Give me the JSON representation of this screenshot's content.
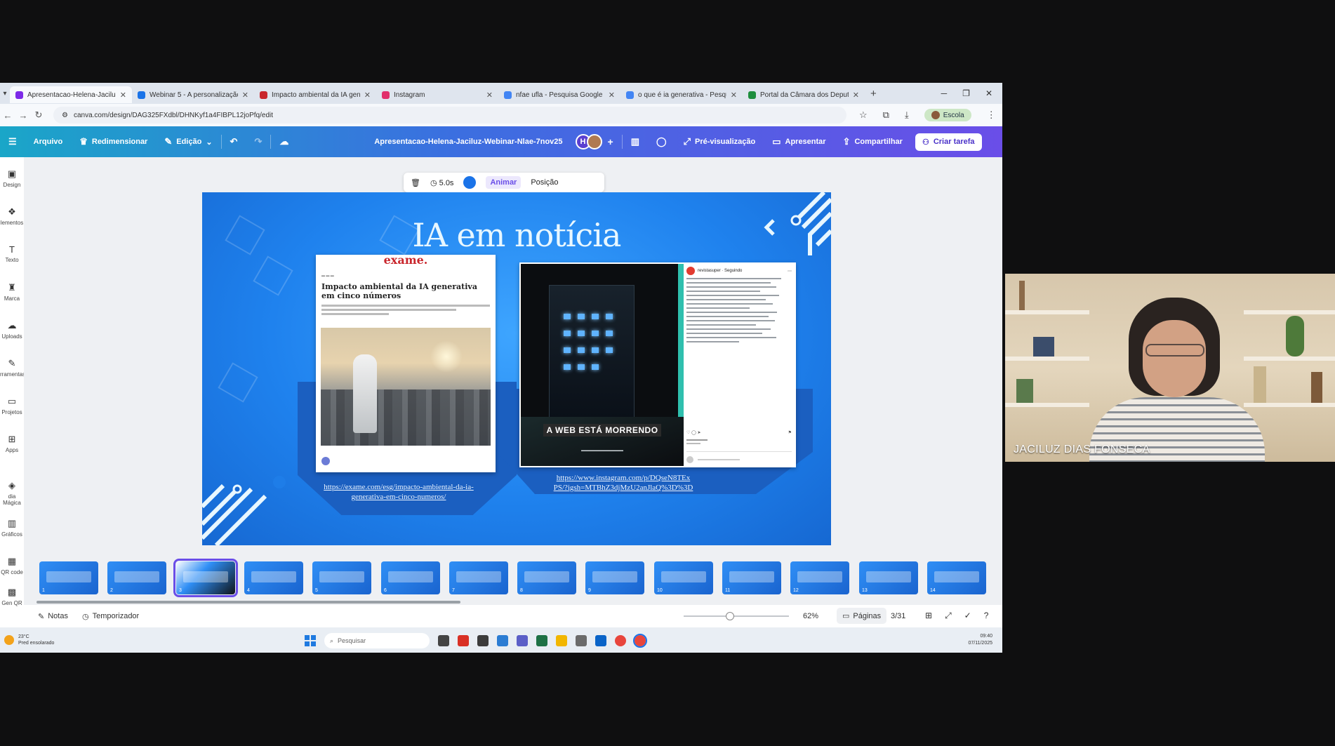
{
  "browser": {
    "tabs": [
      {
        "title": "Apresentacao-Helena-Jaciluz-W",
        "active": true,
        "favicon_color": "#7d2ae8"
      },
      {
        "title": "Webinar 5 - A personalização d",
        "active": false,
        "favicon_color": "#1a73e8"
      },
      {
        "title": "Impacto ambiental da IA gene",
        "active": false,
        "favicon_color": "#c9262c"
      },
      {
        "title": "Instagram",
        "active": false,
        "favicon_color": "#e1306c"
      },
      {
        "title": "nfae ufla - Pesquisa Google",
        "active": false,
        "favicon_color": "#4285f4"
      },
      {
        "title": "o que é ia generativa - Pesqui",
        "active": false,
        "favicon_color": "#4285f4"
      },
      {
        "title": "Portal da Câmara dos Deputad",
        "active": false,
        "favicon_color": "#1e8e3e"
      }
    ],
    "url": "canva.com/design/DAG325FXdbl/DHNKyf1a4FIBPL12joPfq/edit",
    "profile_label": "Escola"
  },
  "canva": {
    "menu": {
      "arquivo": "Arquivo",
      "redimensionar": "Redimensionar",
      "edicao": "Edição"
    },
    "doc_title": "Apresentacao-Helena-Jaciluz-Webinar-Nlae-7nov25",
    "avatar_initial": "H",
    "preview": "Pré-visualização",
    "present": "Apresentar",
    "share": "Compartilhar",
    "create_task": "Criar tarefa",
    "sidebar": [
      {
        "label": "Design",
        "icon": "layout-icon"
      },
      {
        "label": "lementos",
        "icon": "shapes-icon"
      },
      {
        "label": "Texto",
        "icon": "text-icon"
      },
      {
        "label": "Marca",
        "icon": "brand-icon"
      },
      {
        "label": "Uploads",
        "icon": "upload-icon"
      },
      {
        "label": "rramentas",
        "icon": "draw-icon"
      },
      {
        "label": "Projetos",
        "icon": "folder-icon"
      },
      {
        "label": "Apps",
        "icon": "apps-icon"
      },
      {
        "label": "dia Mágica",
        "icon": "magic-media-icon"
      },
      {
        "label": "Gráficos",
        "icon": "chart-icon"
      },
      {
        "label": "QR code",
        "icon": "qr-icon"
      },
      {
        "label": "Gen QR",
        "icon": "qr-gen-icon"
      }
    ],
    "floating_toolbar": {
      "duration": "5.0s",
      "animate": "Animar",
      "position": "Posição"
    },
    "slide": {
      "title": "IA em notícia",
      "news_brand": "exame.",
      "news_headline": "Impacto ambiental da IA generativa em cinco números",
      "insta_account": "revistasuper · Seguindo",
      "insta_caption": "A WEB ESTÁ MORRENDO",
      "link1_line1": "https://exame.com/esg/impacto-ambiental-da-ia-",
      "link1_line2": "generativa-em-cinco-numeros/",
      "link2_line1": "https://www.instagram.com/p/DQseN8TEx",
      "link2_line2": "PS/?igsh=MTBhZ3djMzU2anJlaQ%3D%3D"
    },
    "thumbnails": [
      "1",
      "2",
      "3",
      "4",
      "5",
      "6",
      "7",
      "8",
      "9",
      "10",
      "11",
      "12",
      "13",
      "14"
    ],
    "active_thumbnail": 3,
    "bottom": {
      "notes": "Notas",
      "timer": "Temporizador",
      "zoom": "62%",
      "zoom_fraction": 0.44,
      "pages": "Páginas",
      "page_count": "3/31"
    }
  },
  "taskbar": {
    "weather_temp": "23°C",
    "weather_desc": "Pred ensolarado",
    "search_placeholder": "Pesquisar",
    "time": "09:40",
    "date": "07/11/2025"
  },
  "webcam": {
    "participant_name": "JACILUZ DIAS FONSECA"
  }
}
